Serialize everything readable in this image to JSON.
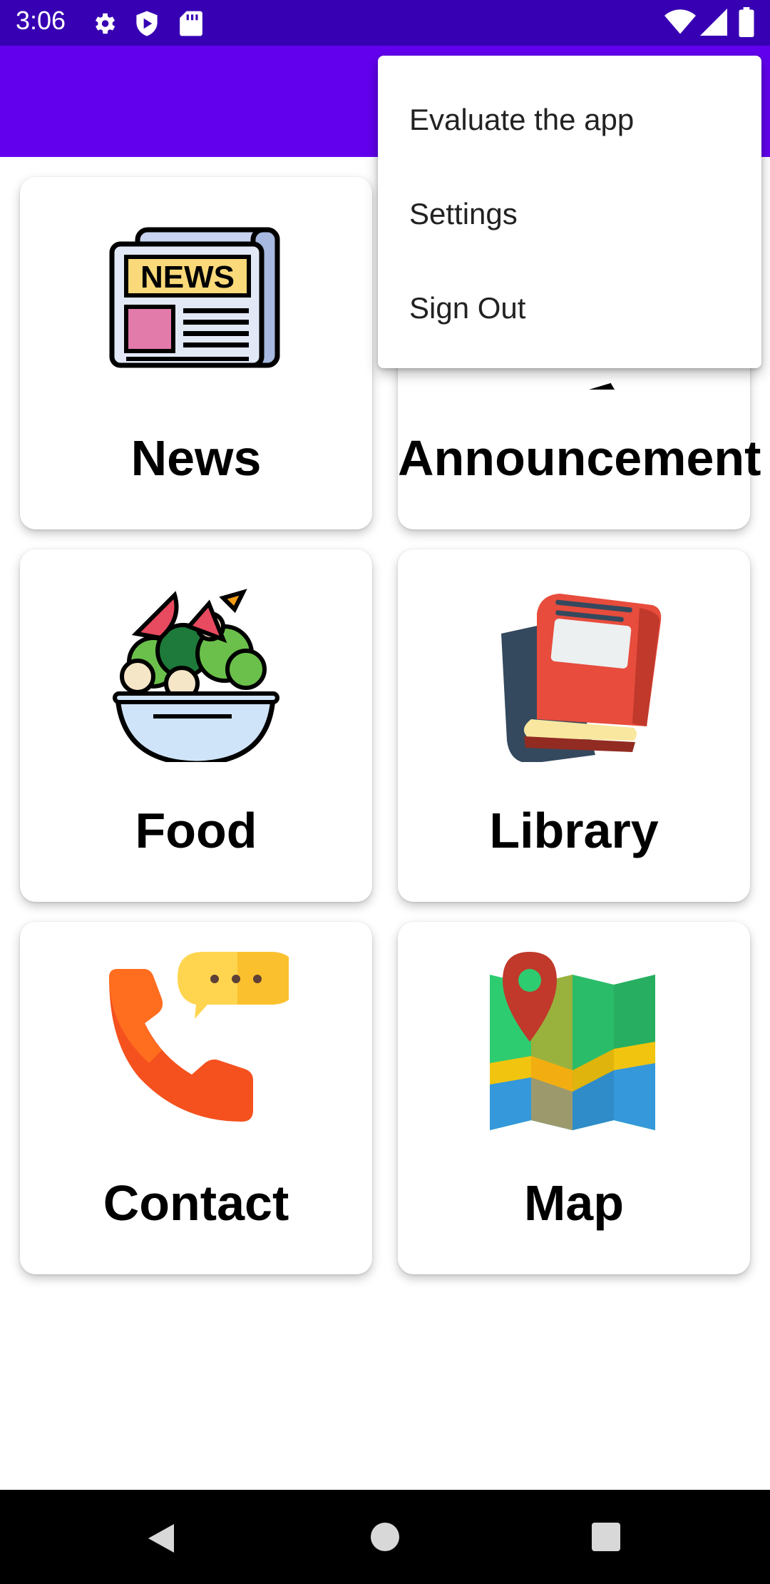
{
  "status_bar": {
    "time": "3:06",
    "left_icons": [
      "gear-icon",
      "shield-play-icon",
      "sd-card-icon"
    ],
    "right_icons": [
      "wifi-icon",
      "cell-signal-icon",
      "battery-icon"
    ]
  },
  "colors": {
    "status_bar": "#3700B3",
    "app_bar": "#6200EE",
    "nav_bar": "#000000",
    "card_bg": "#FFFFFF"
  },
  "grid": {
    "cards": [
      {
        "label": "News",
        "icon": "newspaper-icon"
      },
      {
        "label": "Announcement",
        "icon": "megaphone-icon"
      },
      {
        "label": "Food",
        "icon": "salad-bowl-icon"
      },
      {
        "label": "Library",
        "icon": "books-icon"
      },
      {
        "label": "Contact",
        "icon": "phone-chat-icon"
      },
      {
        "label": "Map",
        "icon": "map-pin-icon"
      }
    ]
  },
  "overflow_menu": {
    "items": [
      {
        "label": "Evaluate the app"
      },
      {
        "label": "Settings"
      },
      {
        "label": "Sign Out"
      }
    ]
  },
  "nav_bar": {
    "buttons": [
      "back-icon",
      "home-icon",
      "recents-icon"
    ]
  }
}
